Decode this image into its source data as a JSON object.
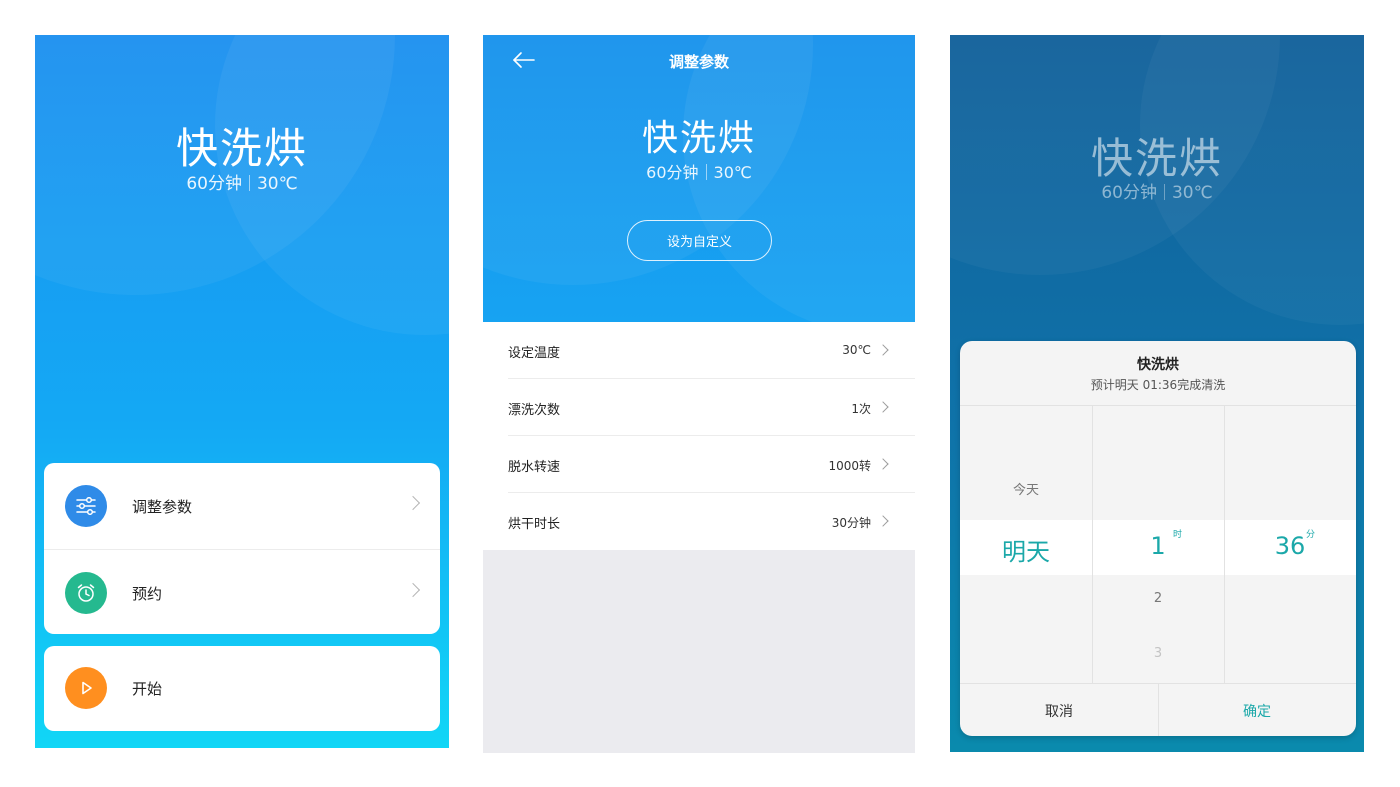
{
  "colors": {
    "accent_blue": "#1a8ff0",
    "cyan": "#11d6f6",
    "teal_selected": "#1ba8a9",
    "adjust_icon_bg": "#2f8be8",
    "schedule_icon_bg": "#25b98f",
    "start_icon_bg": "#ff8f1f"
  },
  "program": {
    "name": "快洗烘",
    "duration": "60分钟",
    "temperature": "30℃"
  },
  "home": {
    "menu": [
      {
        "label": "调整参数",
        "icon": "sliders-icon"
      },
      {
        "label": "预约",
        "icon": "alarm-clock-icon"
      }
    ],
    "start": {
      "label": "开始",
      "icon": "play-icon"
    }
  },
  "adjust": {
    "nav_title": "调整参数",
    "back_icon": "back-arrow-icon",
    "custom_button": "设为自定义",
    "settings": [
      {
        "label": "设定温度",
        "value": "30℃"
      },
      {
        "label": "漂洗次数",
        "value": "1次"
      },
      {
        "label": "脱水转速",
        "value": "1000转"
      },
      {
        "label": "烘干时长",
        "value": "30分钟"
      }
    ]
  },
  "schedule": {
    "dialog_title": "快洗烘",
    "dialog_subtitle": "预计明天 01:36完成清洗",
    "day_above": "今天",
    "day_selected": "明天",
    "hour_selected": "1",
    "hour_unit": "时",
    "hour_below_1": "2",
    "hour_below_2": "3",
    "minute_selected": "36",
    "minute_unit": "分",
    "cancel": "取消",
    "confirm": "确定"
  }
}
